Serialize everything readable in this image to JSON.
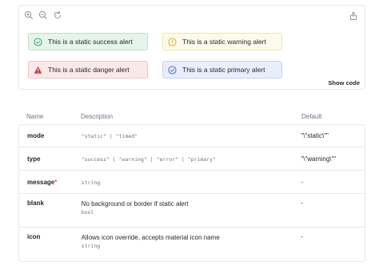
{
  "toolbar": {
    "icons": [
      "zoom-in-icon",
      "zoom-out-icon",
      "reset-icon",
      "share-icon"
    ]
  },
  "alerts": [
    {
      "kind": "success",
      "text": "This is a static success alert",
      "icon": "check-circle-icon",
      "color": "#2e9e5b"
    },
    {
      "kind": "warning",
      "text": "This is a static warning alert",
      "icon": "info-circle-icon",
      "color": "#d4a514"
    },
    {
      "kind": "danger",
      "text": "This is a static danger alert",
      "icon": "warning-triangle-icon",
      "color": "#d23a47"
    },
    {
      "kind": "primary",
      "text": "This is a static primary alert",
      "icon": "check-circle-icon",
      "color": "#3a5bc7"
    }
  ],
  "show_code_label": "Show code",
  "table": {
    "headers": {
      "name": "Name",
      "description": "Description",
      "default": "Default"
    },
    "rows": [
      {
        "name": "mode",
        "description": "",
        "code": "\"static\" | \"timed\"",
        "default": "\"\\\"static\\\"\""
      },
      {
        "name": "type",
        "description": "",
        "code": "\"success\" | \"warning\" | \"error\" | \"primary\"",
        "default": "\"\\\"warning\\\"\""
      },
      {
        "name": "message",
        "required_mark": "*",
        "description": "",
        "code": "string",
        "default": "-"
      },
      {
        "name": "blank",
        "description": "No background or border if static alert",
        "code": "bool",
        "default": "-"
      },
      {
        "name": "icon",
        "description": "Allows icon override, accepts material icon name",
        "code": "string",
        "default": "-"
      }
    ]
  }
}
